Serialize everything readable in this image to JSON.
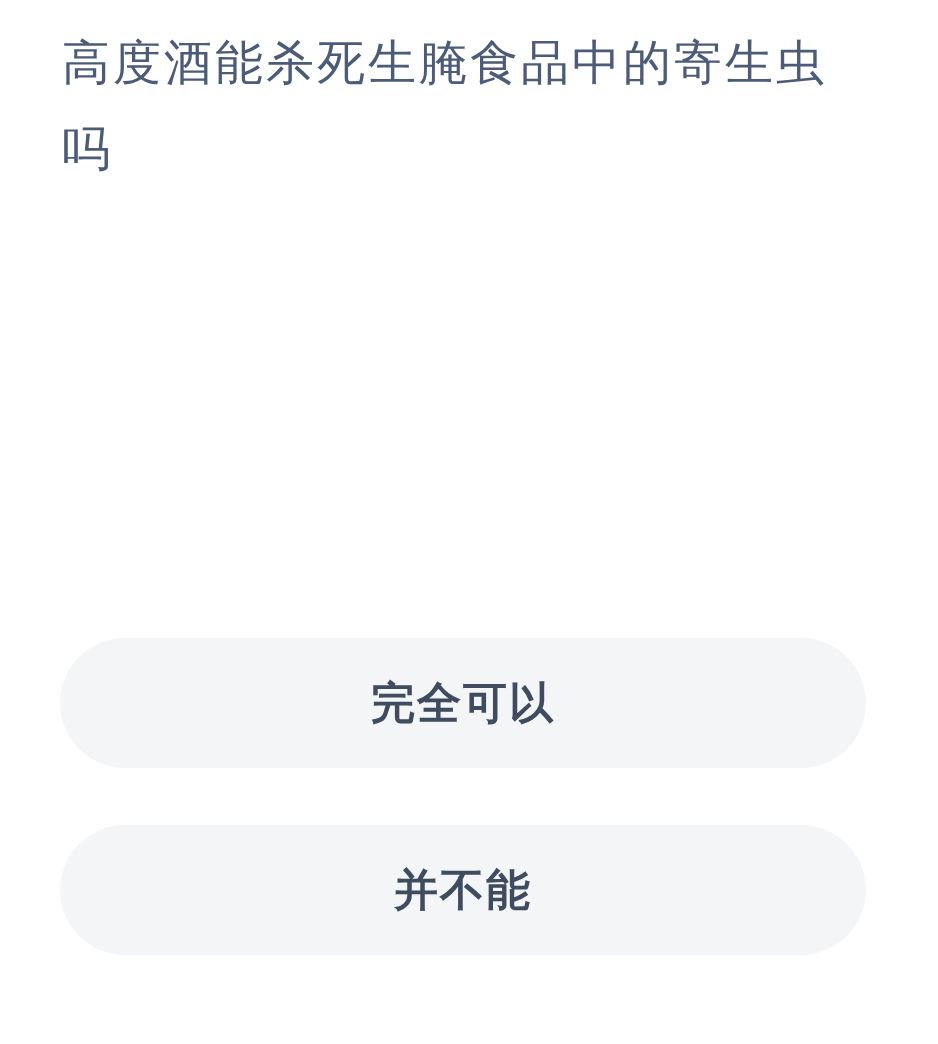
{
  "question": "高度酒能杀死生腌食品中的寄生虫吗",
  "options": [
    {
      "label": "完全可以"
    },
    {
      "label": "并不能"
    }
  ]
}
